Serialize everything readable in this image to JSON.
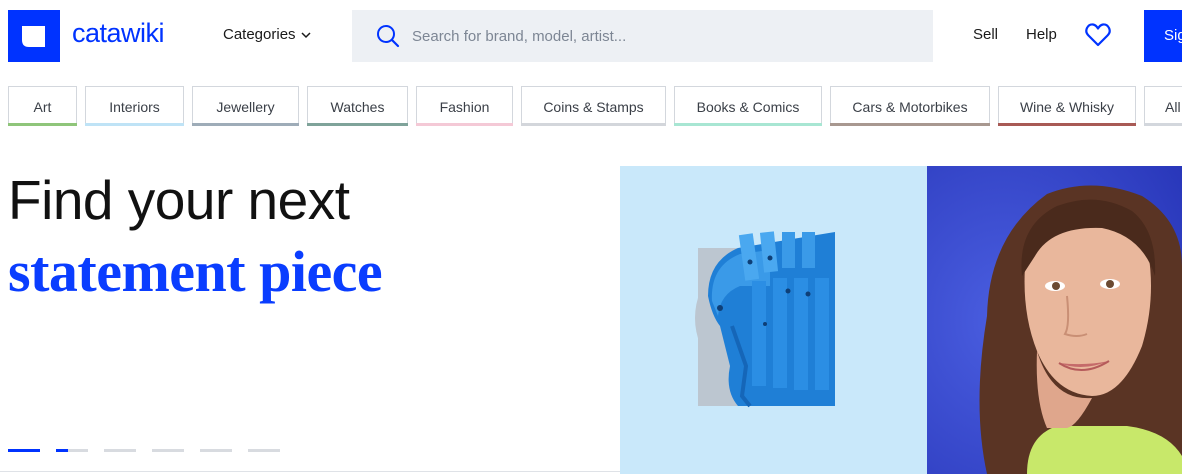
{
  "brand": {
    "name": "catawiki",
    "color": "#0033ff"
  },
  "header": {
    "categories_label": "Categories",
    "search_placeholder": "Search for brand, model, artist...",
    "sell_label": "Sell",
    "help_label": "Help",
    "signin_label": "Sig"
  },
  "category_tabs": [
    {
      "label": "Art",
      "color": "#8fc57a"
    },
    {
      "label": "Interiors",
      "color": "#bfe3f6"
    },
    {
      "label": "Jewellery",
      "color": "#9eacb8"
    },
    {
      "label": "Watches",
      "color": "#7fa39a"
    },
    {
      "label": "Fashion",
      "color": "#f4c9d6"
    },
    {
      "label": "Coins & Stamps",
      "color": "#d3d6db"
    },
    {
      "label": "Books & Comics",
      "color": "#a8e6d3"
    },
    {
      "label": "Cars & Motorbikes",
      "color": "#a89890"
    },
    {
      "label": "Wine & Whisky",
      "color": "#a85a55"
    },
    {
      "label": "All",
      "color": "#d3d7dd"
    }
  ],
  "hero": {
    "line1": "Find your next",
    "line2": "statement piece",
    "slides_total": 6,
    "slide_active": 1
  }
}
